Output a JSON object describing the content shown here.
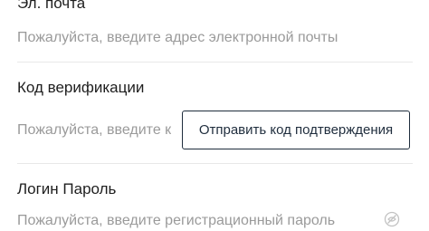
{
  "form": {
    "email": {
      "label": "Эл. почта",
      "placeholder": "Пожалуйста, введите адрес электронной почты"
    },
    "verification": {
      "label": "Код верификации",
      "placeholder": "Пожалуйста, введите код верификации",
      "send_button_label": "Отправить код подтверждения"
    },
    "password": {
      "label": "Логин Пароль",
      "placeholder": "Пожалуйста, введите регистрационный пароль",
      "visibility_icon": "eye-slash-icon"
    }
  },
  "colors": {
    "label_text": "#1e1e1e",
    "placeholder_text": "#9a9a9a",
    "divider": "#e8e8e8",
    "button_border": "#1f2d3d"
  }
}
